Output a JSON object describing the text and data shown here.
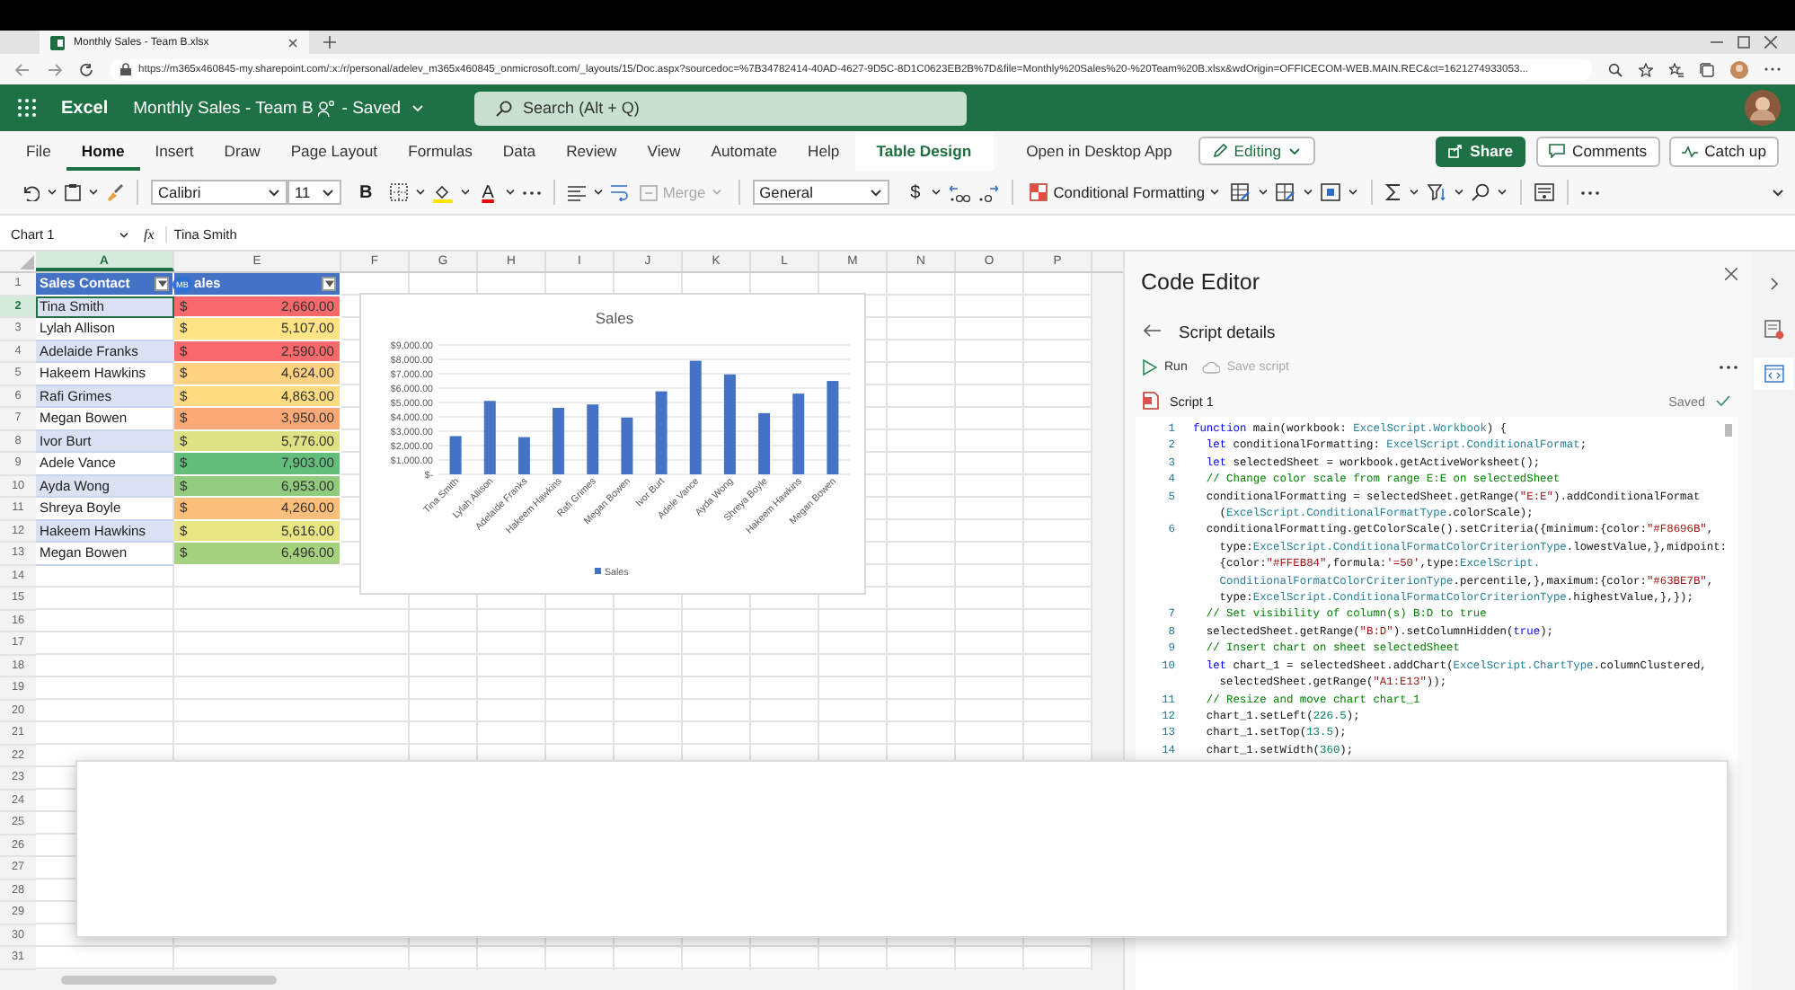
{
  "browser": {
    "tab_title": "Monthly Sales - Team B.xlsx",
    "url": "https://m365x460845-my.sharepoint.com/:x:/r/personal/adelev_m365x460845_onmicrosoft.com/_layouts/15/Doc.aspx?sourcedoc=%7B34782414-40AD-4627-9D5C-8D1C0623EB2B%7D&file=Monthly%20Sales%20-%20Team%20B.xlsx&wdOrigin=OFFICECOM-WEB.MAIN.REC&ct=1621274933053..."
  },
  "app": {
    "name": "Excel",
    "doc_title": "Monthly Sales - Team B",
    "status": "- Saved",
    "search_placeholder": "Search (Alt + Q)"
  },
  "ribbon_tabs": [
    {
      "label": "File",
      "selected": false,
      "kind": "tab"
    },
    {
      "label": "Home",
      "selected": true,
      "kind": "tab"
    },
    {
      "label": "Insert",
      "selected": false,
      "kind": "tab"
    },
    {
      "label": "Draw",
      "selected": false,
      "kind": "tab"
    },
    {
      "label": "Page Layout",
      "selected": false,
      "kind": "tab"
    },
    {
      "label": "Formulas",
      "selected": false,
      "kind": "tab"
    },
    {
      "label": "Data",
      "selected": false,
      "kind": "tab"
    },
    {
      "label": "Review",
      "selected": false,
      "kind": "tab"
    },
    {
      "label": "View",
      "selected": false,
      "kind": "tab"
    },
    {
      "label": "Automate",
      "selected": false,
      "kind": "tab"
    },
    {
      "label": "Help",
      "selected": false,
      "kind": "tab"
    },
    {
      "label": "Table Design",
      "selected": false,
      "kind": "contextual"
    }
  ],
  "open_desktop": "Open in Desktop App",
  "editing": "Editing",
  "share": "Share",
  "comments": "Comments",
  "catch_up": "Catch up",
  "toolbar": {
    "font": "Calibri",
    "size": "11",
    "bold": "B",
    "font_color": "A",
    "merge": {
      "label": "Merge",
      "disabled": true
    },
    "number_format": "General",
    "currency": "$",
    "conditional_formatting": "Conditional Formatting"
  },
  "formula_bar": {
    "name_box": "Chart 1",
    "fx": "fx",
    "value": "Tina Smith"
  },
  "sheet": {
    "columns": [
      "A",
      "E",
      "F",
      "G",
      "H",
      "I",
      "J",
      "K",
      "L",
      "M",
      "N",
      "O",
      "P"
    ],
    "row_numbers": [
      "1",
      "2",
      "3",
      "4",
      "5",
      "6",
      "7",
      "8",
      "9",
      "10",
      "11",
      "12",
      "13",
      "14",
      "15",
      "16",
      "17",
      "18",
      "19",
      "20",
      "21",
      "22",
      "23",
      "24",
      "25",
      "26",
      "27",
      "28",
      "29",
      "30",
      "31"
    ],
    "headers": [
      "Sales Contact",
      "ales"
    ],
    "presence_badge": "MB",
    "rows": [
      {
        "contact": "Tina Smith",
        "currency": "$",
        "sales": "2,660.00",
        "color": "#f8696b",
        "selected": true
      },
      {
        "contact": "Lylah Allison",
        "currency": "$",
        "sales": "5,107.00",
        "color": "#ffe384",
        "selected": false
      },
      {
        "contact": "Adelaide Franks",
        "currency": "$",
        "sales": "2,590.00",
        "color": "#f8696b",
        "selected": false
      },
      {
        "contact": "Hakeem Hawkins",
        "currency": "$",
        "sales": "4,624.00",
        "color": "#fed280",
        "selected": false
      },
      {
        "contact": "Rafi Grimes",
        "currency": "$",
        "sales": "4,863.00",
        "color": "#fedb81",
        "selected": false
      },
      {
        "contact": "Megan Bowen",
        "currency": "$",
        "sales": "3,950.00",
        "color": "#fbaa77",
        "selected": false
      },
      {
        "contact": "Ivor Burt",
        "currency": "$",
        "sales": "5,776.00",
        "color": "#dfe283",
        "selected": false
      },
      {
        "contact": "Adele Vance",
        "currency": "$",
        "sales": "7,903.00",
        "color": "#63be7b",
        "selected": false
      },
      {
        "contact": "Ayda Wong",
        "currency": "$",
        "sales": "6,953.00",
        "color": "#90cb7e",
        "selected": false
      },
      {
        "contact": "Shreya Boyle",
        "currency": "$",
        "sales": "4,260.00",
        "color": "#fcbf7b",
        "selected": false
      },
      {
        "contact": "Hakeem Hawkins",
        "currency": "$",
        "sales": "5,616.00",
        "color": "#e8e583",
        "selected": false
      },
      {
        "contact": "Megan Bowen",
        "currency": "$",
        "sales": "6,496.00",
        "color": "#a6d27f",
        "selected": false
      }
    ]
  },
  "chart": {
    "chart_data": {
      "type": "bar",
      "title": "Sales",
      "grid": true,
      "categories": [
        "Tina Smith",
        "Lylah Allison",
        "Adelaide Franks",
        "Hakeem Hawkins",
        "Rafi Grimes",
        "Megan Bowen",
        "Ivor Burt",
        "Adele Vance",
        "Ayda Wong",
        "Shreya Boyle",
        "Hakeem Hawkins",
        "Megan Bowen"
      ],
      "series": [
        {
          "name": "Sales",
          "color": "#4472c4",
          "values": [
            2660,
            5107,
            2590,
            4624,
            4863,
            3950,
            5776,
            7903,
            6953,
            4260,
            5616,
            6496
          ]
        }
      ],
      "ylim": [
        0,
        9000
      ],
      "yticks": [
        {
          "value": 0,
          "label": "$-"
        },
        {
          "value": 1000,
          "label": "$1,000.00"
        },
        {
          "value": 2000,
          "label": "$2,000.00"
        },
        {
          "value": 3000,
          "label": "$3,000.00"
        },
        {
          "value": 4000,
          "label": "$4,000.00"
        },
        {
          "value": 5000,
          "label": "$5,000.00"
        },
        {
          "value": 6000,
          "label": "$6,000.00"
        },
        {
          "value": 7000,
          "label": "$7,000.00"
        },
        {
          "value": 8000,
          "label": "$8,000.00"
        },
        {
          "value": 9000,
          "label": "$9,000.00"
        }
      ]
    }
  },
  "code_editor": {
    "title": "Code Editor",
    "back_label": "Script details",
    "run": "Run",
    "save": {
      "label": "Save script",
      "disabled": true
    },
    "script_name": "Script 1",
    "save_status": "Saved",
    "signature": {
      "number": "1",
      "lines": [
        [
          {
            "kind": "keyword",
            "text": "function"
          },
          {
            "kind": "plain",
            "text": " main(workbook: "
          },
          {
            "kind": "type",
            "text": "ExcelScript.Workbook"
          },
          {
            "kind": "plain",
            "text": ") {"
          }
        ]
      ]
    },
    "statements": [
      {
        "number": "2",
        "lines": [
          [
            {
              "kind": "keyword",
              "text": "let"
            },
            {
              "kind": "plain",
              "text": " conditionalFormatting: "
            },
            {
              "kind": "type",
              "text": "ExcelScript.ConditionalFormat"
            },
            {
              "kind": "plain",
              "text": ";"
            }
          ]
        ]
      },
      {
        "number": "3",
        "lines": [
          [
            {
              "kind": "keyword",
              "text": "let"
            },
            {
              "kind": "plain",
              "text": " selectedSheet = workbook.getActiveWorksheet();"
            }
          ]
        ]
      },
      {
        "number": "4",
        "lines": [
          [
            {
              "kind": "comment",
              "text": "// Change color scale from range E:E on selectedSheet"
            }
          ]
        ]
      },
      {
        "number": "5",
        "lines": [
          [
            {
              "kind": "plain",
              "text": "conditionalFormatting = selectedSheet.getRange("
            },
            {
              "kind": "string",
              "text": "\"E:E\""
            },
            {
              "kind": "plain",
              "text": ").addConditionalFormat"
            }
          ],
          [
            {
              "kind": "plain",
              "text": "("
            },
            {
              "kind": "type",
              "text": "ExcelScript.ConditionalFormatType"
            },
            {
              "kind": "plain",
              "text": ".colorScale);"
            }
          ]
        ]
      },
      {
        "number": "6",
        "lines": [
          [
            {
              "kind": "plain",
              "text": "conditionalFormatting.getColorScale().setCriteria({minimum:{color:"
            },
            {
              "kind": "string",
              "text": "\"#F8696B\""
            },
            {
              "kind": "plain",
              "text": ","
            }
          ],
          [
            {
              "kind": "plain",
              "text": "type:"
            },
            {
              "kind": "type",
              "text": "ExcelScript.ConditionalFormatColorCriterionType"
            },
            {
              "kind": "plain",
              "text": ".lowestValue,},midpoint:"
            }
          ],
          [
            {
              "kind": "plain",
              "text": "{color:"
            },
            {
              "kind": "string",
              "text": "\"#FFEB84\""
            },
            {
              "kind": "plain",
              "text": ",formula:"
            },
            {
              "kind": "string",
              "text": "'=50'"
            },
            {
              "kind": "plain",
              "text": ",type:"
            },
            {
              "kind": "type",
              "text": "ExcelScript."
            }
          ],
          [
            {
              "kind": "type",
              "text": "ConditionalFormatColorCriterionType"
            },
            {
              "kind": "plain",
              "text": ".percentile,},maximum:{color:"
            },
            {
              "kind": "string",
              "text": "\"#63BE7B\""
            },
            {
              "kind": "plain",
              "text": ","
            }
          ],
          [
            {
              "kind": "plain",
              "text": "type:"
            },
            {
              "kind": "type",
              "text": "ExcelScript.ConditionalFormatColorCriterionType"
            },
            {
              "kind": "plain",
              "text": ".highestValue,},});"
            }
          ]
        ]
      },
      {
        "number": "7",
        "lines": [
          [
            {
              "kind": "comment",
              "text": "// Set visibility of column(s) B:D to true"
            }
          ]
        ]
      },
      {
        "number": "8",
        "lines": [
          [
            {
              "kind": "plain",
              "text": "selectedSheet.getRange("
            },
            {
              "kind": "string",
              "text": "\"B:D\""
            },
            {
              "kind": "plain",
              "text": ").setColumnHidden("
            },
            {
              "kind": "keyword",
              "text": "true"
            },
            {
              "kind": "plain",
              "text": ");"
            }
          ]
        ]
      },
      {
        "number": "9",
        "lines": [
          [
            {
              "kind": "comment",
              "text": "// Insert chart on sheet selectedSheet"
            }
          ]
        ]
      },
      {
        "number": "10",
        "lines": [
          [
            {
              "kind": "keyword",
              "text": "let"
            },
            {
              "kind": "plain",
              "text": " chart_1 = selectedSheet.addChart("
            },
            {
              "kind": "type",
              "text": "ExcelScript.ChartType"
            },
            {
              "kind": "plain",
              "text": ".columnClustered,"
            }
          ],
          [
            {
              "kind": "plain",
              "text": "selectedSheet.getRange("
            },
            {
              "kind": "string",
              "text": "\"A1:E13\""
            },
            {
              "kind": "plain",
              "text": "));"
            }
          ]
        ]
      },
      {
        "number": "11",
        "lines": [
          [
            {
              "kind": "comment",
              "text": "// Resize and move chart chart_1"
            }
          ]
        ]
      },
      {
        "number": "12",
        "lines": [
          [
            {
              "kind": "plain",
              "text": "chart_1.setLeft("
            },
            {
              "kind": "number",
              "text": "226.5"
            },
            {
              "kind": "plain",
              "text": ");"
            }
          ]
        ]
      },
      {
        "number": "13",
        "lines": [
          [
            {
              "kind": "plain",
              "text": "chart_1.setTop("
            },
            {
              "kind": "number",
              "text": "13.5"
            },
            {
              "kind": "plain",
              "text": ");"
            }
          ]
        ]
      },
      {
        "number": "14",
        "lines": [
          [
            {
              "kind": "plain",
              "text": "chart_1.setWidth("
            },
            {
              "kind": "number",
              "text": "360"
            },
            {
              "kind": "plain",
              "text": ");"
            }
          ]
        ]
      }
    ]
  }
}
